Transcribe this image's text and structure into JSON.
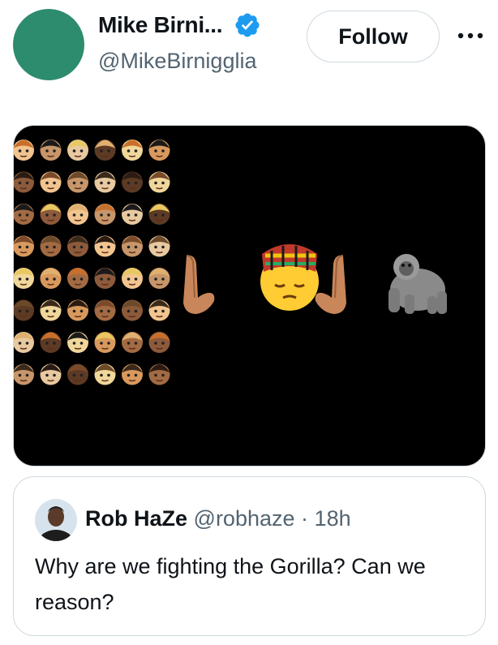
{
  "author": {
    "display_name": "Mike Birni...",
    "handle": "@MikeBirnigglia",
    "verified": true,
    "avatar_color": "#2e8c6e"
  },
  "actions": {
    "follow_label": "Follow",
    "more_icon": "more-horizontal-icon"
  },
  "media": {
    "background": "#000000",
    "emoji_grid": {
      "rows": 8,
      "cols": 6,
      "icon": "person-emoji-icon"
    },
    "center_sequence": [
      "raised-back-of-hand-left-icon",
      "pensive-face-kente-hat-icon",
      "raised-back-of-hand-right-icon",
      "gorilla-icon"
    ]
  },
  "quote": {
    "display_name": "Rob HaZe",
    "handle": "@robhaze",
    "separator": "·",
    "time": "18h",
    "text": "Why are we fighting the Gorilla? Can we reason?"
  },
  "colors": {
    "verified_blue": "#1d9bf0",
    "secondary_text": "#536471",
    "border": "#cfd9de"
  }
}
